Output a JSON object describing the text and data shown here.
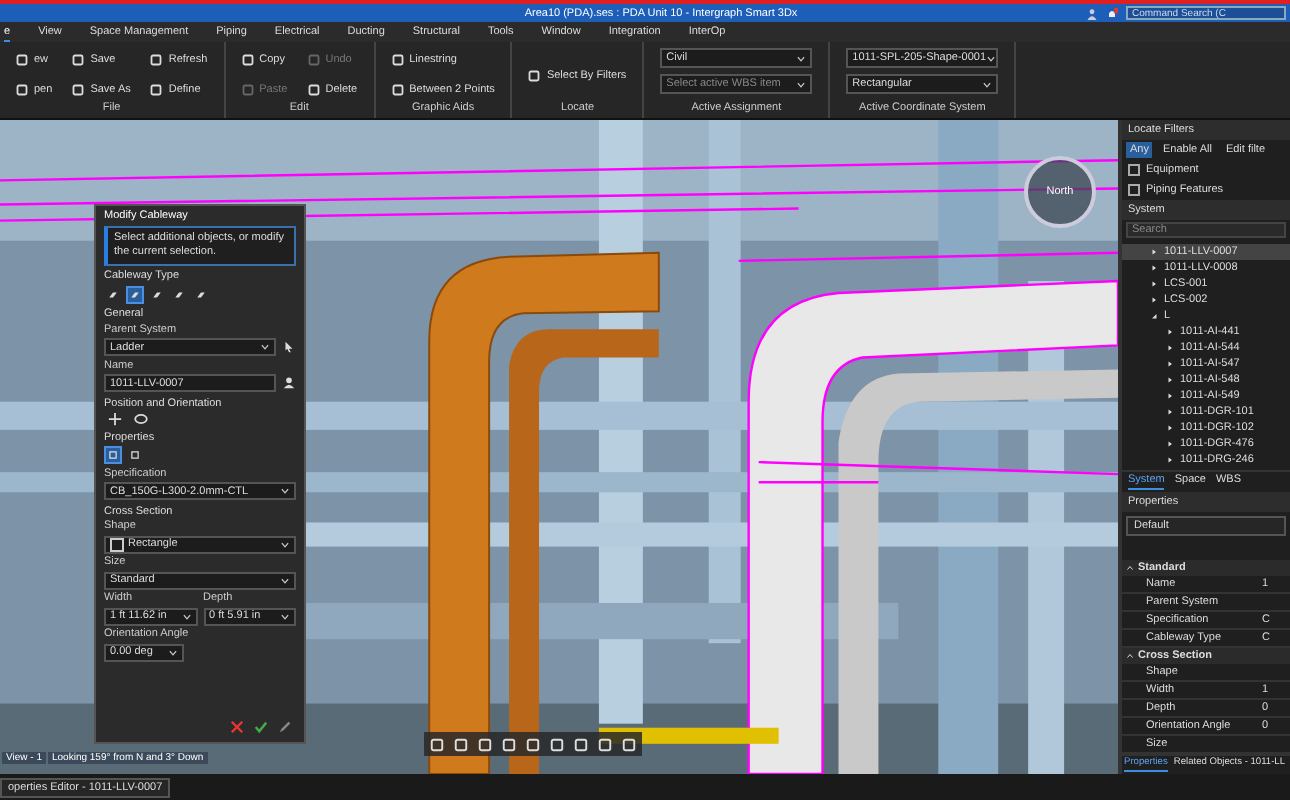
{
  "window": {
    "title": "Area10 (PDA).ses : PDA Unit 10 - Intergraph Smart 3Dx",
    "search_placeholder": "Command Search (C"
  },
  "menu_tabs": [
    {
      "label": "e",
      "selected": true
    },
    {
      "label": "View",
      "selected": false
    },
    {
      "label": "Space Management",
      "selected": false
    },
    {
      "label": "Piping",
      "selected": false
    },
    {
      "label": "Electrical",
      "selected": false
    },
    {
      "label": "Ducting",
      "selected": false
    },
    {
      "label": "Structural",
      "selected": false
    },
    {
      "label": "Tools",
      "selected": false
    },
    {
      "label": "Window",
      "selected": false
    },
    {
      "label": "Integration",
      "selected": false
    },
    {
      "label": "InterOp",
      "selected": false
    }
  ],
  "ribbon": [
    {
      "label": "File",
      "kind": "buttons",
      "items": [
        {
          "label": "ew",
          "disabled": false
        },
        {
          "label": "pen",
          "disabled": false
        },
        {
          "label": "Save",
          "disabled": false
        },
        {
          "label": "Save As",
          "disabled": false
        },
        {
          "label": "Refresh",
          "disabled": false
        },
        {
          "label": "Define",
          "disabled": false
        }
      ]
    },
    {
      "label": "Edit",
      "kind": "buttons",
      "items": [
        {
          "label": "Copy",
          "disabled": false
        },
        {
          "label": "Paste",
          "disabled": true
        },
        {
          "label": "Undo",
          "disabled": true
        },
        {
          "label": "Delete",
          "disabled": false
        }
      ]
    },
    {
      "label": "Graphic Aids",
      "kind": "buttons",
      "items": [
        {
          "label": "Linestring",
          "disabled": false
        },
        {
          "label": "Between 2 Points",
          "disabled": false
        }
      ]
    },
    {
      "label": "Locate",
      "kind": "buttons",
      "items": [
        {
          "label": "Select By Filters",
          "disabled": false
        }
      ]
    },
    {
      "label": "Active Assignment",
      "kind": "dropdowns",
      "items": [
        {
          "value": "Civil"
        },
        {
          "placeholder": "Select active WBS item"
        }
      ]
    },
    {
      "label": "Active Coordinate System",
      "kind": "dropdowns",
      "items": [
        {
          "value": "1011-SPL-205-Shape-0001"
        },
        {
          "value": "Rectangular"
        }
      ]
    }
  ],
  "viewport": {
    "compass_label": "North",
    "view_name": "View - 1",
    "view_direction": "Looking 159° from N and 3° Down"
  },
  "modify_panel": {
    "title": "Modify Cableway",
    "hint": "Select additional objects, or modify the current selection.",
    "cableway_type_label": "Cableway Type",
    "cableway_types": [
      {
        "selected": false
      },
      {
        "selected": true
      },
      {
        "selected": false
      },
      {
        "selected": false
      },
      {
        "selected": false
      }
    ],
    "general_label": "General",
    "parent_system_label": "Parent System",
    "parent_system": "Ladder",
    "name_label": "Name",
    "name": "1011-LLV-0007",
    "position_label": "Position and Orientation",
    "properties_label": "Properties",
    "property_views": [
      {
        "selected": true
      },
      {
        "selected": false
      }
    ],
    "specification_label": "Specification",
    "specification": "CB_150G-L300-2.0mm-CTL",
    "cross_section_label": "Cross Section",
    "shape_label": "Shape",
    "shape": "Rectangle",
    "size_label": "Size",
    "size": "Standard",
    "width_label": "Width",
    "width": "1 ft 11.62 in",
    "depth_label": "Depth",
    "depth": "0 ft 5.91 in",
    "angle_label": "Orientation Angle",
    "angle": "0.00 deg"
  },
  "locate_filters": {
    "title": "Locate Filters",
    "buttons": [
      {
        "label": "Any",
        "selected": true
      },
      {
        "label": "Enable All",
        "selected": false
      },
      {
        "label": "Edit filte",
        "selected": false
      }
    ],
    "filters": [
      {
        "label": "Equipment",
        "checked": false
      },
      {
        "label": "Piping Features",
        "checked": false
      }
    ]
  },
  "system": {
    "title": "System",
    "search_placeholder": "Search",
    "tree": [
      {
        "label": "1011-LLV-0007",
        "selected": true
      },
      {
        "label": "1011-LLV-0008",
        "selected": false
      },
      {
        "label": "LCS-001",
        "selected": false
      },
      {
        "label": "LCS-002",
        "selected": false
      },
      {
        "label": "L",
        "selected": false,
        "expanded": true,
        "children": [
          {
            "label": "1011-AI-441",
            "selected": false
          },
          {
            "label": "1011-AI-544",
            "selected": false
          },
          {
            "label": "1011-AI-547",
            "selected": false
          },
          {
            "label": "1011-AI-548",
            "selected": false
          },
          {
            "label": "1011-AI-549",
            "selected": false
          },
          {
            "label": "1011-DGR-101",
            "selected": false
          },
          {
            "label": "1011-DGR-102",
            "selected": false
          },
          {
            "label": "1011-DGR-476",
            "selected": false
          },
          {
            "label": "1011-DRG-246",
            "selected": false
          }
        ]
      }
    ],
    "tabs": [
      {
        "label": "System",
        "selected": true
      },
      {
        "label": "Space",
        "selected": false
      },
      {
        "label": "WBS",
        "selected": false
      }
    ]
  },
  "properties": {
    "title": "Properties",
    "view": "Default",
    "categories": [
      {
        "label": "Standard",
        "expanded": true,
        "rows": [
          {
            "name": "Name",
            "value": "1"
          },
          {
            "name": "Parent System"
          },
          {
            "name": "Specification",
            "value": "C"
          },
          {
            "name": "Cableway Type",
            "value": "C"
          }
        ]
      },
      {
        "label": "Cross Section",
        "expanded": true,
        "rows": [
          {
            "name": "Shape"
          },
          {
            "name": "Width",
            "value": "1"
          },
          {
            "name": "Depth",
            "value": "0"
          },
          {
            "name": "Orientation Angle",
            "value": "0"
          },
          {
            "name": "Size"
          }
        ]
      }
    ],
    "tabs": [
      {
        "label": "Properties",
        "selected": true
      },
      {
        "label": "Related Objects - 1011-LL",
        "selected": false
      }
    ]
  },
  "status_bar": {
    "document_tab": "operties Editor - 1011-LLV-0007"
  }
}
